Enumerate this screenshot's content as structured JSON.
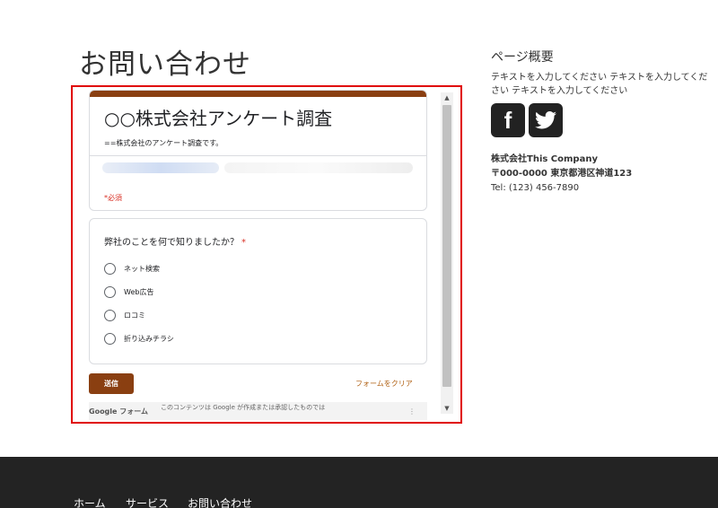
{
  "page": {
    "title": "お問い合わせ"
  },
  "form": {
    "title": "○○株式会社アンケート調査",
    "description": "==株式会社のアンケート調査です。",
    "required_note": "*必須",
    "question": {
      "label": "弊社のことを何で知りましたか？",
      "required_mark": "*"
    },
    "options": [
      "ネット検索",
      "Web広告",
      "ロコミ",
      "折り込みチラシ"
    ],
    "submit_label": "送信",
    "clear_label": "フォームをクリア",
    "google_forms_label": "Google フォーム",
    "disclaimer": "このコンテンツは Google が作成または承認したものでは"
  },
  "sidebar": {
    "title": "ページ概要",
    "text": "テキストを入力してください テキストを入力してください テキストを入力してください",
    "social": {
      "facebook": "f",
      "twitter": "twitter-icon"
    },
    "company_name": "株式会社This Company",
    "address": "〒000-0000 東京都港区神道123",
    "tel": "Tel: (123) 456-7890"
  },
  "footer": {
    "nav": [
      "ホーム",
      "サービス",
      "お問い合わせ"
    ]
  },
  "colors": {
    "accent": "#8a3f11",
    "highlight": "#e00000",
    "footer_bg": "#232323"
  }
}
